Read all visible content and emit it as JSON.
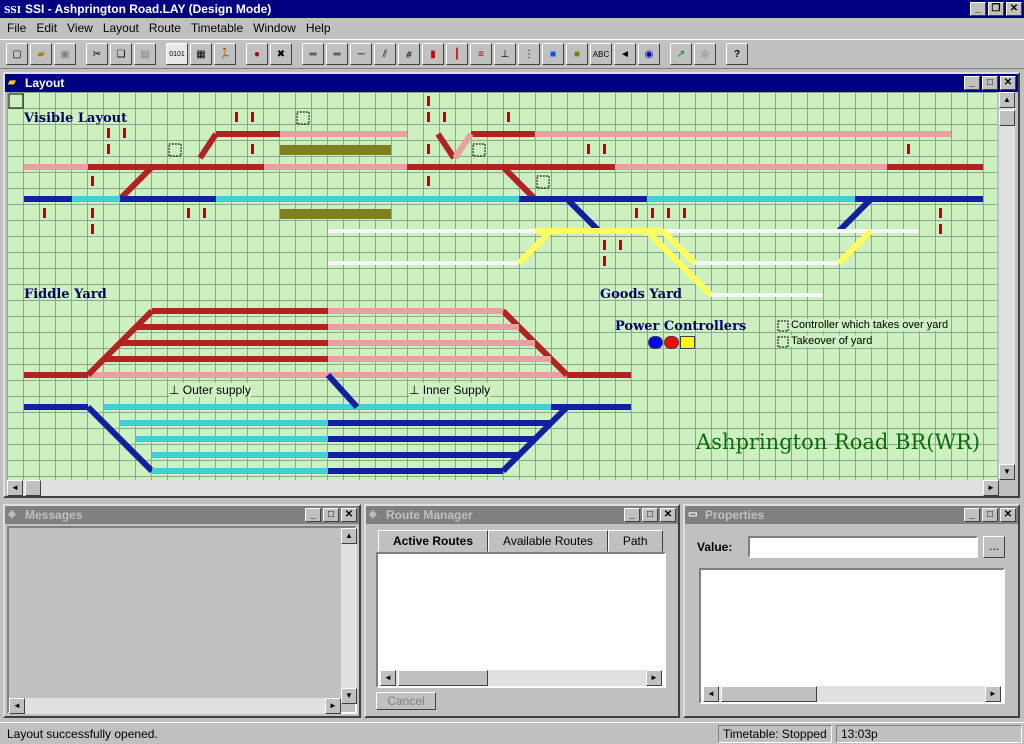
{
  "app": {
    "logo": "SSI",
    "title": "SSI - Ashprington Road.LAY (Design Mode)"
  },
  "menu": [
    "File",
    "Edit",
    "View",
    "Layout",
    "Route",
    "Timetable",
    "Window",
    "Help"
  ],
  "toolbar_icons": [
    "new-icon",
    "open-icon",
    "save-icon",
    "cut-icon",
    "copy-icon",
    "paste-icon",
    "binary-icon",
    "grid-icon",
    "walk-icon",
    "trains-icon",
    "no-trains-icon",
    "track-icon",
    "double-track-icon",
    "plain-track-icon",
    "crossover-icon",
    "diamond-icon",
    "signal-icon",
    "shunt-signal-icon",
    "buffer-icon",
    "supply-icon",
    "controller-icon",
    "power-icon",
    "yellow-block-icon",
    "label-icon",
    "speaker-icon",
    "target-icon",
    "route-icon",
    "clock-icon",
    "help-icon"
  ],
  "layout_window": {
    "title": "Layout",
    "labels": {
      "visible": "Visible Layout",
      "fiddle": "Fiddle Yard",
      "goods": "Goods Yard",
      "power": "Power Controllers",
      "outer": "Outer supply",
      "inner": "Inner Supply",
      "legend1": "Controller which takes over yard",
      "legend2": "Takeover of yard",
      "brand": "Ashprington Road BR(WR)"
    },
    "controller_colors": [
      "#0000ff",
      "#ff0000",
      "#ffff00"
    ]
  },
  "messages": {
    "title": "Messages"
  },
  "route_manager": {
    "title": "Route Manager",
    "tabs": [
      "Active Routes",
      "Available Routes",
      "Path"
    ],
    "cancel": "Cancel"
  },
  "properties": {
    "title": "Properties",
    "value_label": "Value:",
    "value": "",
    "browse": "..."
  },
  "status": {
    "message": "Layout successfully opened.",
    "timetable": "Timetable: Stopped",
    "time": "13:03p"
  }
}
